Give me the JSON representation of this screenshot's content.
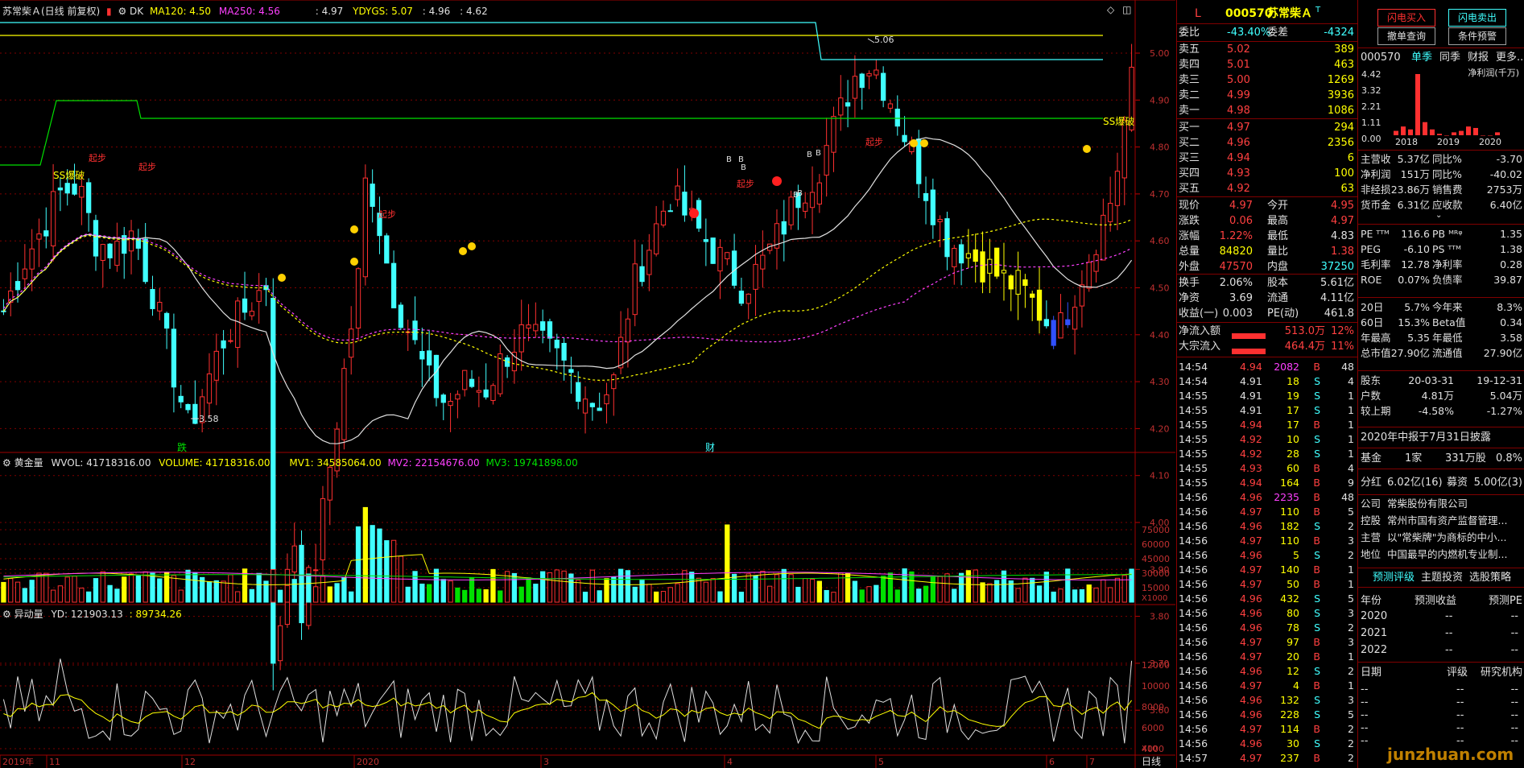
{
  "header": {
    "title": "苏常柴Ａ(日线 前复权)",
    "dk": "DK",
    "ma120": "MA120: 4.50",
    "ma250": "MA250: 4.56",
    "v1": ": 4.97",
    "ydygs": "YDYGS: 5.07",
    "v2": ": 4.96",
    "v3": ": 4.62",
    "colors": {
      "ma120": "#ffff00",
      "ma250": "#ff40ff",
      "up": "#ff3030",
      "down": "#40ffff",
      "grid": "#800000"
    }
  },
  "price_axis": [
    "5.00",
    "4.90",
    "4.80",
    "4.70",
    "4.60",
    "4.50",
    "4.40",
    "4.30",
    "4.20",
    "4.10",
    "4.00",
    "3.90",
    "3.80",
    "3.70",
    "3.60"
  ],
  "price_marks": {
    "high": "5.06",
    "low": "3.58"
  },
  "annotations": {
    "ss_left": "SS爆破",
    "ss_right": "SS爆破",
    "qibu": "起步",
    "b": "B",
    "s": "S",
    "die": "跌",
    "cai": "财"
  },
  "volume_panel": {
    "title": "黄金量",
    "wvol": "WVOL: 41718316.00",
    "volume": "VOLUME: 41718316.00",
    "mv1": "MV1: 34585064.00",
    "mv2": "MV2: 22154676.00",
    "mv3": "MV3: 19741898.00",
    "axis": [
      "75000",
      "60000",
      "45000",
      "30000",
      "15000"
    ],
    "unit": "X1000"
  },
  "ydl_panel": {
    "title": "异动量",
    "yd": "YD: 121903.13",
    "v": ": 89734.26",
    "axis": [
      "12000",
      "10000",
      "8000",
      "6000",
      "4000"
    ],
    "unit": "X10"
  },
  "time_axis": {
    "labels": [
      "2019年",
      "11",
      "12",
      "2020",
      "3",
      "4",
      "5",
      "6",
      "7"
    ],
    "period": "日线"
  },
  "quote": {
    "code": "000570",
    "name": "苏常柴Ａ",
    "l_mark": "L",
    "t_mark": "T",
    "weibi_label": "委比",
    "weibi": "-43.40%",
    "weicha_label": "委差",
    "weicha": "-4324",
    "asks": [
      {
        "label": "卖五",
        "price": "5.02",
        "vol": "389"
      },
      {
        "label": "卖四",
        "price": "5.01",
        "vol": "463"
      },
      {
        "label": "卖三",
        "price": "5.00",
        "vol": "1269"
      },
      {
        "label": "卖二",
        "price": "4.99",
        "vol": "3936"
      },
      {
        "label": "卖一",
        "price": "4.98",
        "vol": "1086"
      }
    ],
    "bids": [
      {
        "label": "买一",
        "price": "4.97",
        "vol": "294"
      },
      {
        "label": "买二",
        "price": "4.96",
        "vol": "2356"
      },
      {
        "label": "买三",
        "price": "4.94",
        "vol": "6"
      },
      {
        "label": "买四",
        "price": "4.93",
        "vol": "100"
      },
      {
        "label": "买五",
        "price": "4.92",
        "vol": "63"
      }
    ],
    "stats": [
      {
        "l1": "现价",
        "v1": "4.97",
        "l2": "今开",
        "v2": "4.95"
      },
      {
        "l1": "涨跌",
        "v1": "0.06",
        "l2": "最高",
        "v2": "4.97"
      },
      {
        "l1": "涨幅",
        "v1": "1.22%",
        "l2": "最低",
        "v2": "4.83"
      },
      {
        "l1": "总量",
        "v1": "84820",
        "l2": "量比",
        "v2": "1.38"
      },
      {
        "l1": "外盘",
        "v1": "47570",
        "l2": "内盘",
        "v2": "37250"
      }
    ],
    "stats2": [
      {
        "l1": "换手",
        "v1": "2.06%",
        "l2": "股本",
        "v2": "5.61亿"
      },
      {
        "l1": "净资",
        "v1": "3.69",
        "l2": "流通",
        "v2": "4.11亿"
      },
      {
        "l1": "收益(一)",
        "v1": "0.003",
        "l2": "PE(动)",
        "v2": "461.8"
      }
    ],
    "flows": [
      {
        "label": "净流入额",
        "value": "513.0万",
        "pct": "12%"
      },
      {
        "label": "大宗流入",
        "value": "464.4万",
        "pct": "11%"
      }
    ],
    "ticks": [
      {
        "t": "14:54",
        "p": "4.94",
        "v": "2082",
        "bs": "B",
        "n": "48"
      },
      {
        "t": "14:54",
        "p": "4.91",
        "v": "18",
        "bs": "S",
        "n": "4"
      },
      {
        "t": "14:55",
        "p": "4.91",
        "v": "19",
        "bs": "S",
        "n": "1"
      },
      {
        "t": "14:55",
        "p": "4.91",
        "v": "17",
        "bs": "S",
        "n": "1"
      },
      {
        "t": "14:55",
        "p": "4.94",
        "v": "17",
        "bs": "B",
        "n": "1"
      },
      {
        "t": "14:55",
        "p": "4.92",
        "v": "10",
        "bs": "S",
        "n": "1"
      },
      {
        "t": "14:55",
        "p": "4.92",
        "v": "28",
        "bs": "S",
        "n": "1"
      },
      {
        "t": "14:55",
        "p": "4.93",
        "v": "60",
        "bs": "B",
        "n": "4"
      },
      {
        "t": "14:55",
        "p": "4.94",
        "v": "164",
        "bs": "B",
        "n": "9"
      },
      {
        "t": "14:56",
        "p": "4.96",
        "v": "2235",
        "bs": "B",
        "n": "48"
      },
      {
        "t": "14:56",
        "p": "4.97",
        "v": "110",
        "bs": "B",
        "n": "5"
      },
      {
        "t": "14:56",
        "p": "4.96",
        "v": "182",
        "bs": "S",
        "n": "2"
      },
      {
        "t": "14:56",
        "p": "4.97",
        "v": "110",
        "bs": "B",
        "n": "3"
      },
      {
        "t": "14:56",
        "p": "4.96",
        "v": "5",
        "bs": "S",
        "n": "2"
      },
      {
        "t": "14:56",
        "p": "4.97",
        "v": "140",
        "bs": "B",
        "n": "1"
      },
      {
        "t": "14:56",
        "p": "4.97",
        "v": "50",
        "bs": "B",
        "n": "1"
      },
      {
        "t": "14:56",
        "p": "4.96",
        "v": "432",
        "bs": "S",
        "n": "5"
      },
      {
        "t": "14:56",
        "p": "4.96",
        "v": "80",
        "bs": "S",
        "n": "3"
      },
      {
        "t": "14:56",
        "p": "4.96",
        "v": "78",
        "bs": "S",
        "n": "2"
      },
      {
        "t": "14:56",
        "p": "4.97",
        "v": "97",
        "bs": "B",
        "n": "3"
      },
      {
        "t": "14:56",
        "p": "4.97",
        "v": "20",
        "bs": "B",
        "n": "1"
      },
      {
        "t": "14:56",
        "p": "4.96",
        "v": "12",
        "bs": "S",
        "n": "2"
      },
      {
        "t": "14:56",
        "p": "4.97",
        "v": "4",
        "bs": "B",
        "n": "1"
      },
      {
        "t": "14:56",
        "p": "4.96",
        "v": "132",
        "bs": "S",
        "n": "3"
      },
      {
        "t": "14:56",
        "p": "4.96",
        "v": "228",
        "bs": "S",
        "n": "5"
      },
      {
        "t": "14:56",
        "p": "4.97",
        "v": "114",
        "bs": "B",
        "n": "2"
      },
      {
        "t": "14:56",
        "p": "4.96",
        "v": "30",
        "bs": "S",
        "n": "2"
      },
      {
        "t": "14:57",
        "p": "4.97",
        "v": "237",
        "bs": "B",
        "n": "2"
      }
    ]
  },
  "info": {
    "buttons": [
      "闪电买入",
      "闪电卖出",
      "撤单查询",
      "条件预警"
    ],
    "tabs": [
      "000570",
      "单季",
      "同季",
      "财报",
      "更多.."
    ],
    "mini_chart": {
      "unit": "净利润(千万)",
      "yaxis": [
        "4.42",
        "3.32",
        "2.21",
        "1.11",
        "0.00"
      ],
      "xaxis": [
        "2018",
        "2019",
        "2020"
      ],
      "bars": [
        0.3,
        0.6,
        0.4,
        4.2,
        0.9,
        0.4,
        0.1,
        0.0,
        0.2,
        0.3,
        0.6,
        0.5,
        0.0,
        0.0,
        0.2
      ]
    },
    "fin": [
      {
        "l1": "主营收",
        "v1": "5.37亿",
        "l2": "同比%",
        "v2": "-3.70"
      },
      {
        "l1": "净利润",
        "v1": "151万",
        "l2": "同比%",
        "v2": "-40.02"
      },
      {
        "l1": "非经损",
        "v1": "23.86万",
        "l2": "销售费",
        "v2": "2753万"
      },
      {
        "l1": "货币金",
        "v1": "6.31亿",
        "l2": "应收款",
        "v2": "6.40亿"
      }
    ],
    "val": [
      {
        "l1": "PE ᵀᵀᴹ",
        "v1": "116.6",
        "l2": "PB ᴹᴿᵠ",
        "v2": "1.35"
      },
      {
        "l1": "PEG",
        "v1": "-6.10",
        "l2": "PS ᵀᵀᴹ",
        "v2": "1.38"
      },
      {
        "l1": "毛利率",
        "v1": "12.78",
        "l2": "净利率",
        "v2": "0.28"
      },
      {
        "l1": "ROE",
        "v1": "0.07%",
        "l2": "负债率",
        "v2": "39.87"
      }
    ],
    "perf": [
      {
        "l1": "20日",
        "v1": "5.7%",
        "l2": "今年来",
        "v2": "8.3%"
      },
      {
        "l1": "60日",
        "v1": "15.3%",
        "l2": "Beta值",
        "v2": "0.34"
      },
      {
        "l1": "年最高",
        "v1": "5.35",
        "l2": "年最低",
        "v2": "3.58"
      },
      {
        "l1": "总市值",
        "v1": "27.90亿",
        "l2": "流通值",
        "v2": "27.90亿"
      }
    ],
    "holders": [
      {
        "l": "股东",
        "a": "20-03-31",
        "b": "19-12-31"
      },
      {
        "l": "户数",
        "a": "4.81万",
        "b": "5.04万"
      },
      {
        "l": "较上期",
        "a": "-4.58%",
        "b": "-1.27%"
      }
    ],
    "report_notice": "2020年中报于7月31日披露",
    "fund": {
      "l": "基金",
      "a": "1家",
      "b": "331万股",
      "c": "0.8%"
    },
    "dividend": {
      "l": "分红",
      "a": "6.02亿(16)",
      "l2": "募资",
      "b": "5.00亿(3)"
    },
    "company": [
      {
        "l": "公司",
        "v": "常柴股份有限公司"
      },
      {
        "l": "控股",
        "v": "常州市国有资产监督管理..."
      },
      {
        "l": "主营",
        "v": "以\"常柴牌\"为商标的中小..."
      },
      {
        "l": "地位",
        "v": "中国最早的内燃机专业制..."
      }
    ],
    "bottom_tabs": [
      "预测评级",
      "主题投资",
      "选股策略"
    ],
    "forecast_head": [
      "年份",
      "预测收益",
      "预测PE"
    ],
    "forecast": [
      {
        "y": "2020",
        "a": "--",
        "b": "--"
      },
      {
        "y": "2021",
        "a": "--",
        "b": "--"
      },
      {
        "y": "2022",
        "a": "--",
        "b": "--"
      }
    ],
    "rating_head": [
      "日期",
      "评级",
      "研究机构"
    ],
    "rating_rows": [
      "--",
      "--",
      "--",
      "--",
      "--"
    ],
    "watermark": "junzhuan.com"
  }
}
